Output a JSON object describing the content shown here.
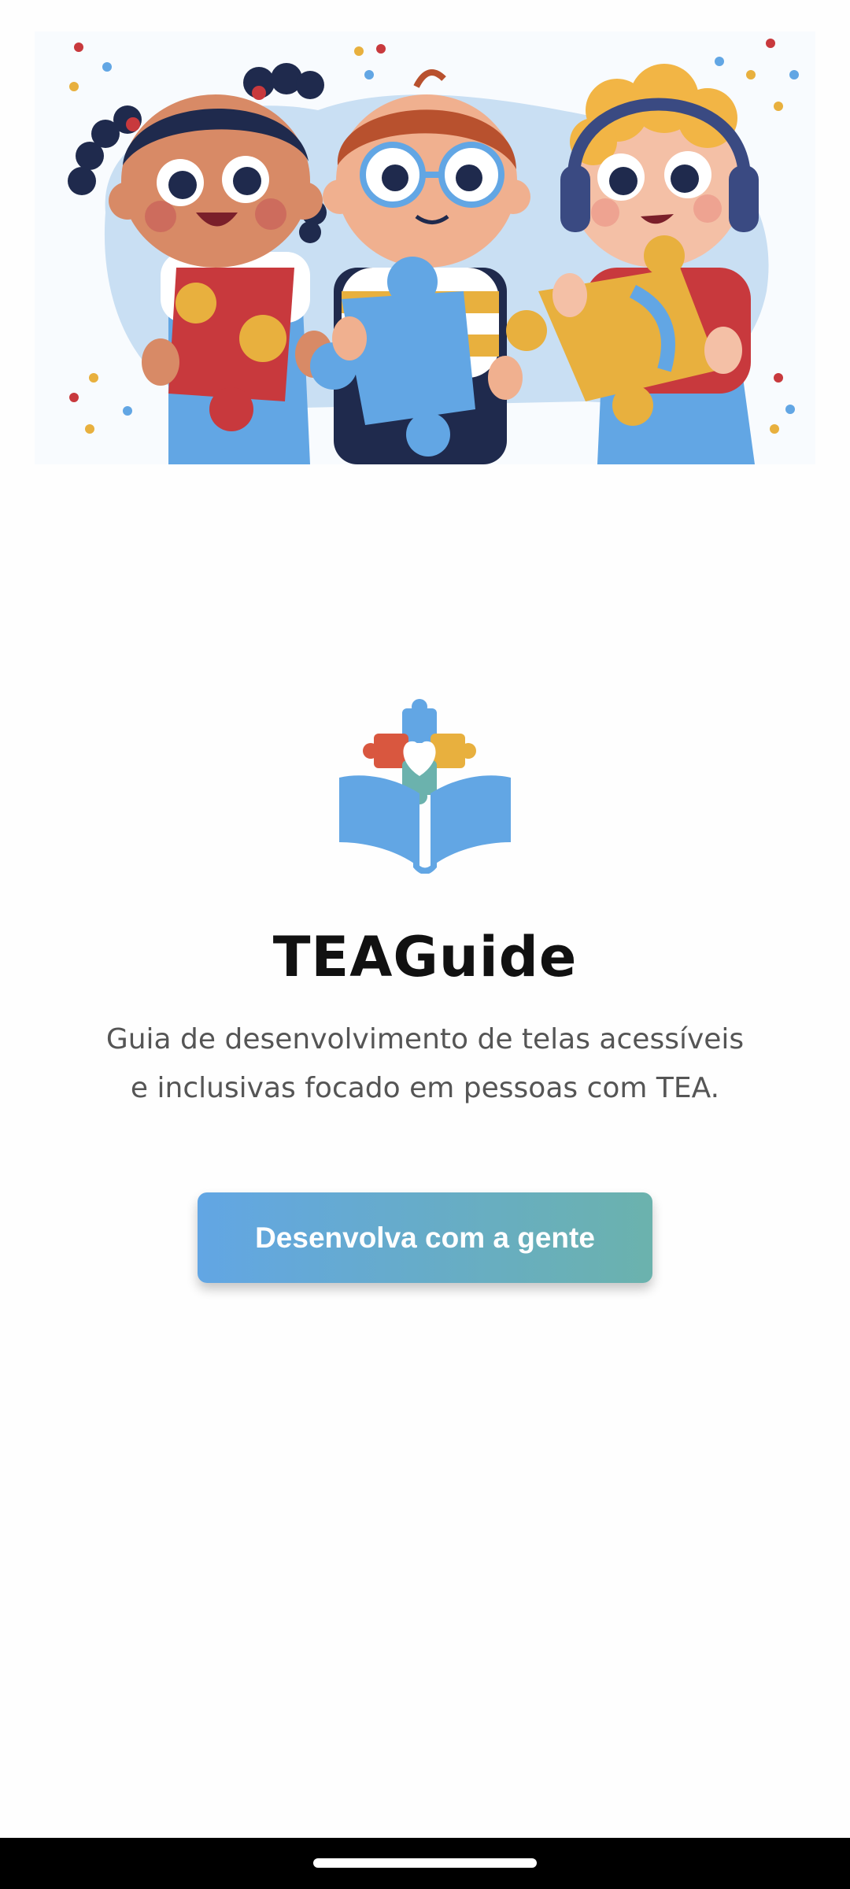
{
  "hero": {
    "illustration_icon": "children-with-puzzle-pieces-illustration"
  },
  "logo": {
    "icon": "puzzle-heart-book-icon",
    "colors": {
      "book": "#62a6e4",
      "puzzle_red": "#d9573f",
      "puzzle_yellow": "#e8b03e",
      "puzzle_blue": "#62a6e4",
      "puzzle_teal": "#6bb2ad"
    }
  },
  "app": {
    "title": "TEAGuide",
    "description_line1": "Guia de desenvolvimento de telas acessíveis",
    "description_line2": "e inclusivas focado em pessoas com TEA."
  },
  "cta": {
    "label": "Desenvolva com a gente",
    "gradient_start": "#62a6e4",
    "gradient_end": "#6bb2ad"
  },
  "system": {
    "home_indicator_icon": "home-gesture-bar"
  }
}
